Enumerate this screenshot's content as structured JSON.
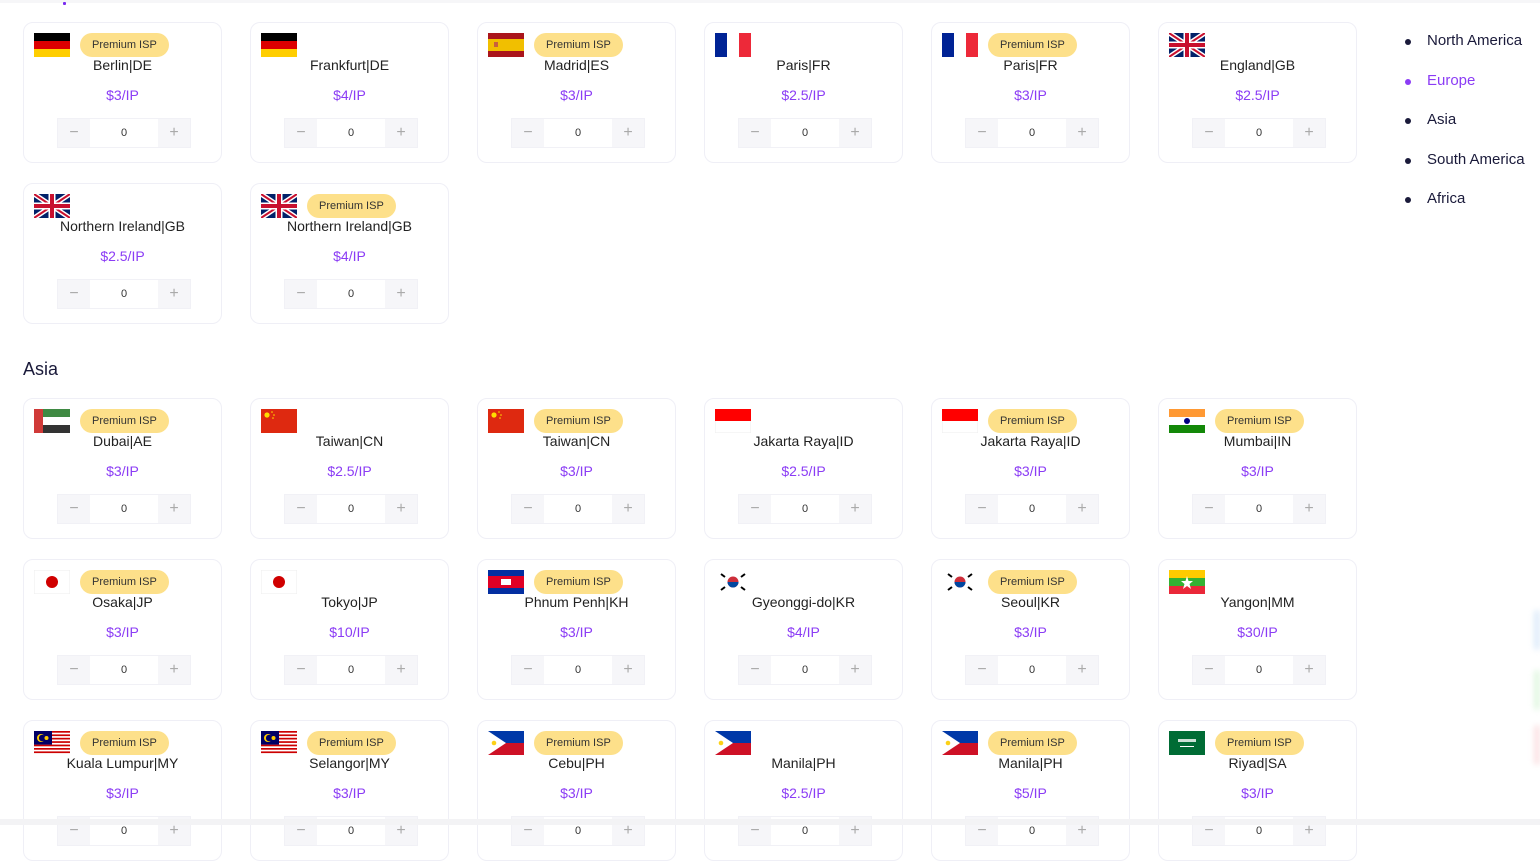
{
  "side_nav": {
    "items": [
      {
        "label": "North America",
        "active": false
      },
      {
        "label": "Europe",
        "active": true
      },
      {
        "label": "Asia",
        "active": false
      },
      {
        "label": "South America",
        "active": false
      },
      {
        "label": "Africa",
        "active": false
      }
    ]
  },
  "colors": {
    "accent": "#8b3cf5",
    "badge_bg": "#fde08a",
    "text": "#1a1a3a"
  },
  "badge_label": "Premium ISP",
  "sections": [
    {
      "title": "",
      "cards": [
        {
          "flag": "DE",
          "premium": true,
          "city": "Berlin|DE",
          "price": "$3/IP",
          "qty": "0"
        },
        {
          "flag": "DE",
          "premium": false,
          "city": "Frankfurt|DE",
          "price": "$4/IP",
          "qty": "0"
        },
        {
          "flag": "ES",
          "premium": true,
          "city": "Madrid|ES",
          "price": "$3/IP",
          "qty": "0"
        },
        {
          "flag": "FR",
          "premium": false,
          "city": "Paris|FR",
          "price": "$2.5/IP",
          "qty": "0"
        },
        {
          "flag": "FR",
          "premium": true,
          "city": "Paris|FR",
          "price": "$3/IP",
          "qty": "0"
        },
        {
          "flag": "GB",
          "premium": false,
          "city": "England|GB",
          "price": "$2.5/IP",
          "qty": "0"
        },
        {
          "flag": "GB",
          "premium": false,
          "city": "Northern Ireland|GB",
          "price": "$2.5/IP",
          "qty": "0"
        },
        {
          "flag": "GB",
          "premium": true,
          "city": "Northern Ireland|GB",
          "price": "$4/IP",
          "qty": "0"
        }
      ]
    },
    {
      "title": "Asia",
      "cards": [
        {
          "flag": "AE",
          "premium": true,
          "city": "Dubai|AE",
          "price": "$3/IP",
          "qty": "0"
        },
        {
          "flag": "CN",
          "premium": false,
          "city": "Taiwan|CN",
          "price": "$2.5/IP",
          "qty": "0"
        },
        {
          "flag": "CN",
          "premium": true,
          "city": "Taiwan|CN",
          "price": "$3/IP",
          "qty": "0"
        },
        {
          "flag": "ID",
          "premium": false,
          "city": "Jakarta Raya|ID",
          "price": "$2.5/IP",
          "qty": "0"
        },
        {
          "flag": "ID",
          "premium": true,
          "city": "Jakarta Raya|ID",
          "price": "$3/IP",
          "qty": "0"
        },
        {
          "flag": "IN",
          "premium": true,
          "city": "Mumbai|IN",
          "price": "$3/IP",
          "qty": "0"
        },
        {
          "flag": "JP",
          "premium": true,
          "city": "Osaka|JP",
          "price": "$3/IP",
          "qty": "0"
        },
        {
          "flag": "JP",
          "premium": false,
          "city": "Tokyo|JP",
          "price": "$10/IP",
          "qty": "0"
        },
        {
          "flag": "KH",
          "premium": true,
          "city": "Phnum Penh|KH",
          "price": "$3/IP",
          "qty": "0"
        },
        {
          "flag": "KR",
          "premium": false,
          "city": "Gyeonggi-do|KR",
          "price": "$4/IP",
          "qty": "0"
        },
        {
          "flag": "KR",
          "premium": true,
          "city": "Seoul|KR",
          "price": "$3/IP",
          "qty": "0"
        },
        {
          "flag": "MM",
          "premium": false,
          "city": "Yangon|MM",
          "price": "$30/IP",
          "qty": "0"
        },
        {
          "flag": "MY",
          "premium": true,
          "city": "Kuala Lumpur|MY",
          "price": "$3/IP",
          "qty": "0"
        },
        {
          "flag": "MY",
          "premium": true,
          "city": "Selangor|MY",
          "price": "$3/IP",
          "qty": "0"
        },
        {
          "flag": "PH",
          "premium": true,
          "city": "Cebu|PH",
          "price": "$3/IP",
          "qty": "0"
        },
        {
          "flag": "PH",
          "premium": false,
          "city": "Manila|PH",
          "price": "$2.5/IP",
          "qty": "0"
        },
        {
          "flag": "PH",
          "premium": true,
          "city": "Manila|PH",
          "price": "$5/IP",
          "qty": "0"
        },
        {
          "flag": "SA",
          "premium": true,
          "city": "Riyad|SA",
          "price": "$3/IP",
          "qty": "0"
        }
      ]
    }
  ],
  "stepper": {
    "minus": "−",
    "plus": "+"
  }
}
